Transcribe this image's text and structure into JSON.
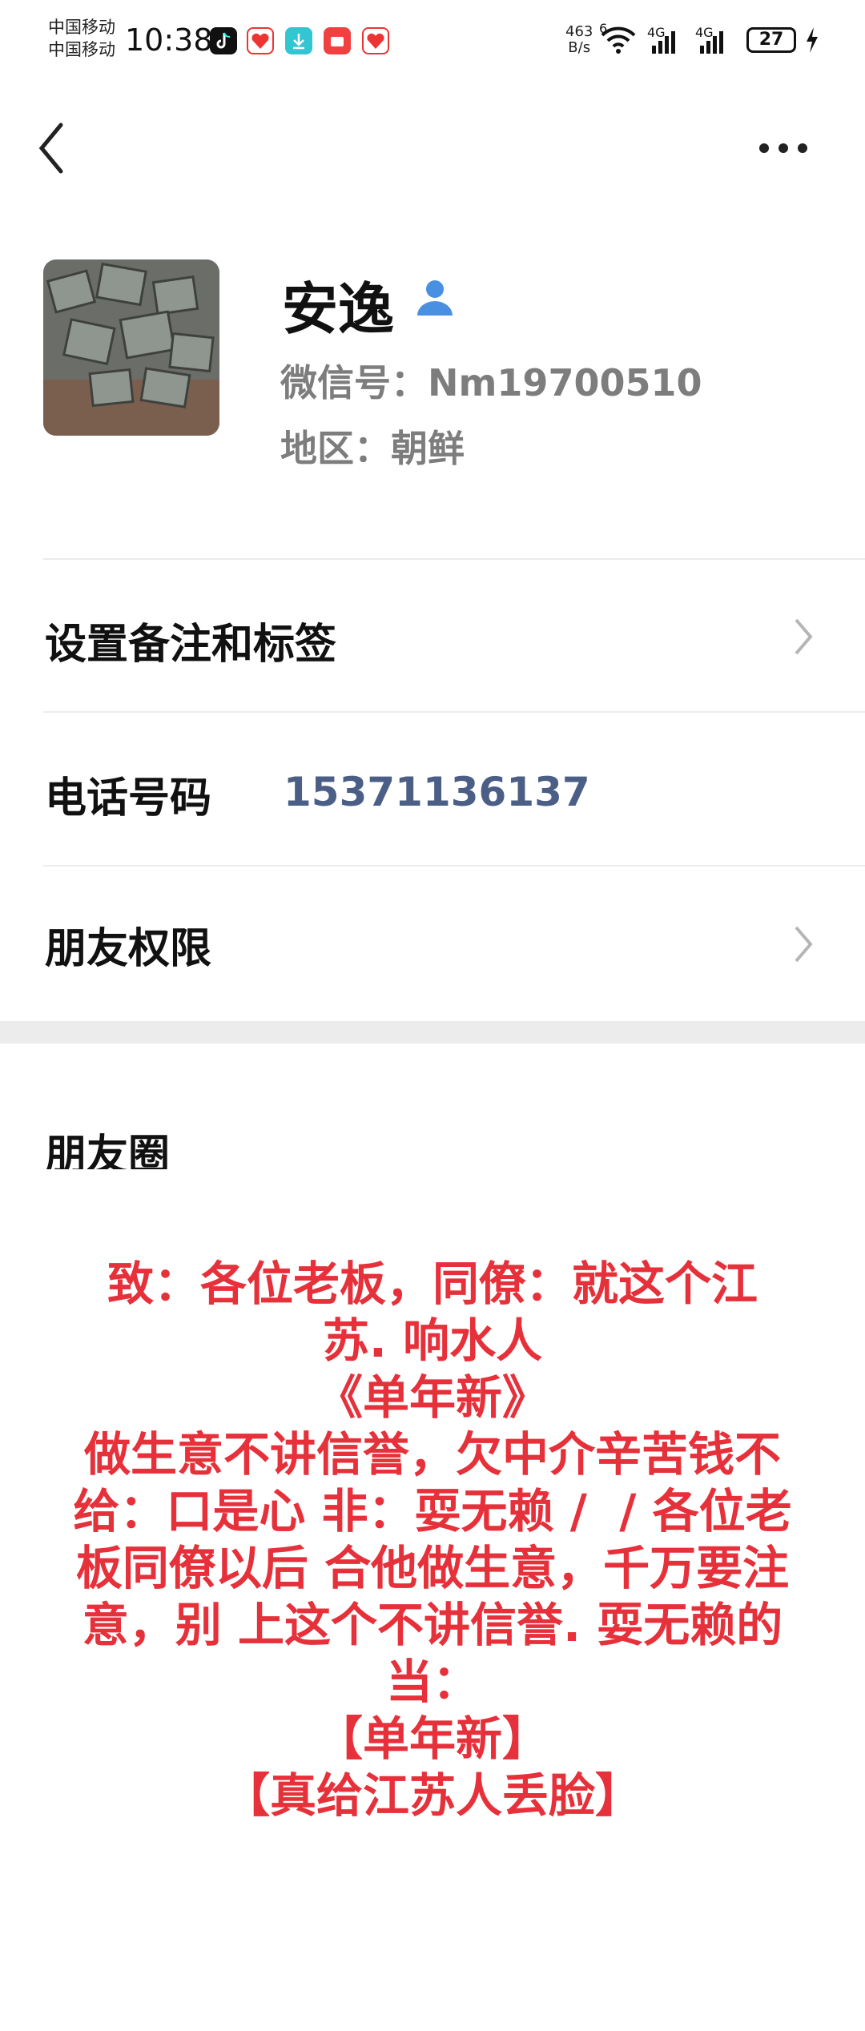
{
  "status_bar": {
    "carrier_1": "中国移动",
    "carrier_2": "中国移动",
    "time": "10:38",
    "net_speed_value": "463",
    "net_speed_unit": "B/s",
    "wifi_label": "6",
    "signal_1_label": "4G",
    "signal_2_label": "4G",
    "battery": "27"
  },
  "profile": {
    "name": "安逸",
    "wechat_id": "微信号：Nm19700510",
    "region": "地区：朝鲜"
  },
  "rows": {
    "remark_label": "设置备注和标签",
    "phone_label": "电话号码",
    "phone_number": "15371136137",
    "permission_label": "朋友权限",
    "moments_label": "朋友圈"
  },
  "overlay_text": [
    "致：各位老板，同僚：就这个江",
    "苏. 响水人",
    "《单年新》",
    "做生意不讲信誉，欠中介辛苦钱不",
    "给：口是心 非：耍无赖 /  / 各位老",
    "板同僚以后 合他做生意，千万要注",
    "意，别 上这个不讲信誉. 耍无赖的",
    "当：",
    "【单年新】",
    "【真给江苏人丢脸】"
  ],
  "colors": {
    "overlay_red": "#e6303a",
    "phone_blue": "#4b5f86",
    "muted_gray": "#7d7d7d",
    "person_icon_blue": "#4a90e2"
  }
}
